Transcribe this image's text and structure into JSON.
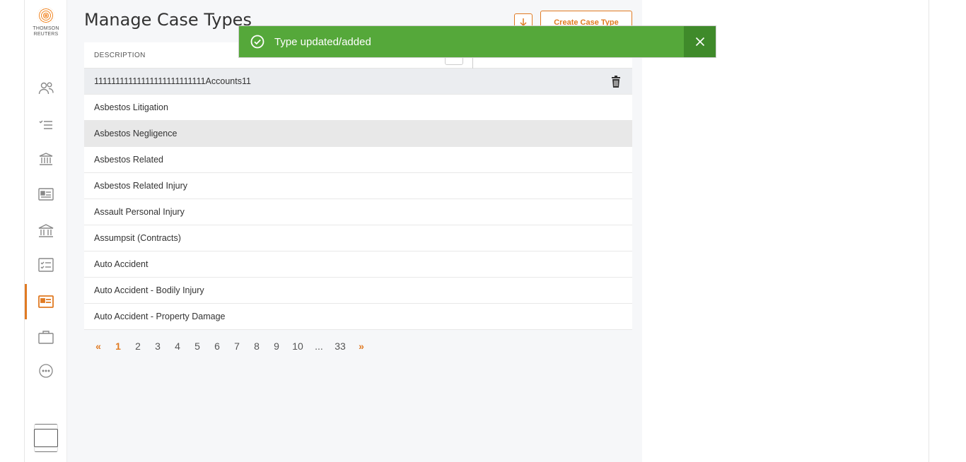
{
  "logo": {
    "line1": "THOMSON",
    "line2": "REUTERS"
  },
  "sidebar": {
    "items": [
      {
        "name": "people-icon"
      },
      {
        "name": "checklist-icon"
      },
      {
        "name": "courthouse-icon"
      },
      {
        "name": "id-card-icon"
      },
      {
        "name": "bank-icon"
      },
      {
        "name": "task-list-icon"
      },
      {
        "name": "case-type-icon",
        "active": true
      },
      {
        "name": "briefcase-icon"
      },
      {
        "name": "more-icon"
      }
    ]
  },
  "header": {
    "title": "Manage Case Types",
    "create_label": "Create Case Type"
  },
  "table": {
    "column_header": "DESCRIPTION",
    "rows": [
      "11111111111111111111111111Accounts11",
      "Asbestos Litigation",
      "Asbestos Negligence",
      "Asbestos Related",
      "Asbestos Related Injury",
      "Assault Personal Injury",
      "Assumpsit (Contracts)",
      "Auto Accident",
      "Auto Accident - Bodily Injury",
      "Auto Accident - Property Damage"
    ]
  },
  "pagination": {
    "prev": "«",
    "pages": [
      "1",
      "2",
      "3",
      "4",
      "5",
      "6",
      "7",
      "8",
      "9",
      "10",
      "...",
      "33"
    ],
    "current": "1",
    "next": "»"
  },
  "toast": {
    "message": "Type updated/added",
    "close": "✕"
  },
  "colors": {
    "accent": "#e07a22",
    "toast_bg": "#55a83a",
    "toast_close_bg": "#3f8a2a"
  }
}
